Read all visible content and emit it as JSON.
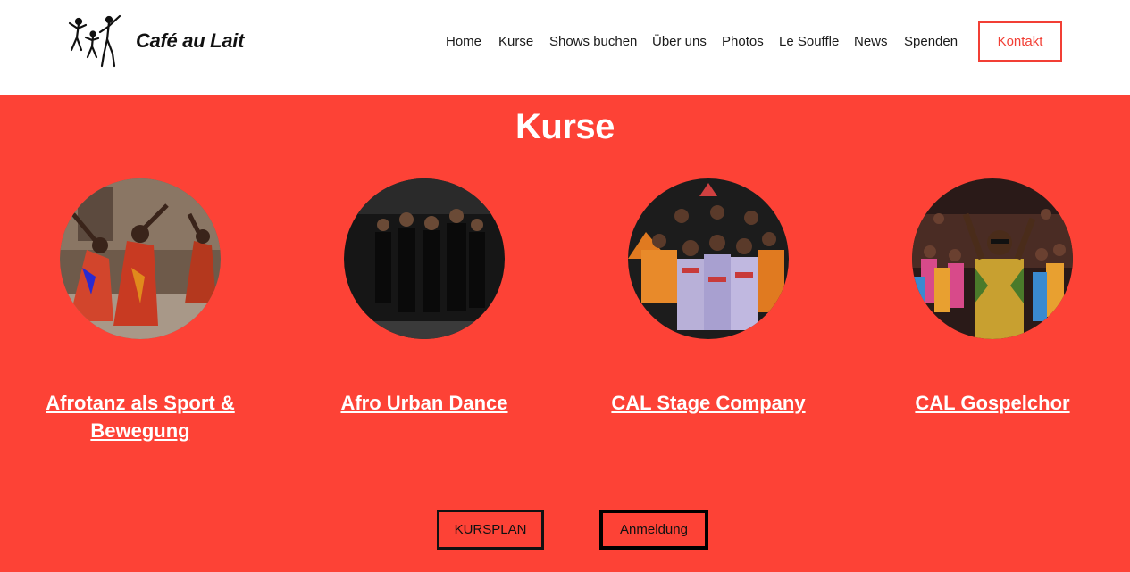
{
  "header": {
    "brand": "Café au Lait",
    "logo_icon": "dancers-logo-icon",
    "nav": [
      "Home",
      "Kurse",
      "Shows buchen",
      "Über uns",
      "Photos",
      "Le Souffle",
      "News",
      "Spenden"
    ],
    "contact_label": "Kontakt"
  },
  "colors": {
    "accent": "#fd4236",
    "contact_border": "#f23f35",
    "text_dark": "#1a1a1a"
  },
  "section": {
    "title": "Kurse",
    "courses": [
      {
        "label": "Afrotanz als Sport & Bewegung",
        "image": "afrotanz-photo"
      },
      {
        "label": "Afro Urban Dance",
        "image": "afro-urban-dance-photo"
      },
      {
        "label": "CAL Stage Company",
        "image": "stage-company-photo"
      },
      {
        "label": "CAL Gospelchor",
        "image": "gospelchor-photo"
      }
    ],
    "buttons": {
      "kursplan": "KURSPLAN",
      "anmeldung": "Anmeldung"
    }
  }
}
